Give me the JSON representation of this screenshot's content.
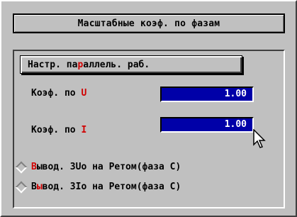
{
  "title": "Масштабные коэф. по фазам",
  "parallel_button": {
    "before": "Настр. па",
    "hotkey": "р",
    "after": "аллель. раб."
  },
  "coef_u": {
    "prefix": "Коэф. по ",
    "phase": "U",
    "value": "1.00"
  },
  "coef_i": {
    "prefix": "Коэф. по ",
    "phase": "I",
    "value": "1.00"
  },
  "options": [
    {
      "hotkey": "В",
      "rest": "ывод. 3Uo на Ретом(фаза С)"
    },
    {
      "hotkey": "ы",
      "first": "В",
      "rest": "вод. 3Io на Ретом(фаза С)"
    }
  ],
  "colors": {
    "background": "#c0c0c0",
    "field": "#0000a8",
    "accent": "#d00000"
  }
}
